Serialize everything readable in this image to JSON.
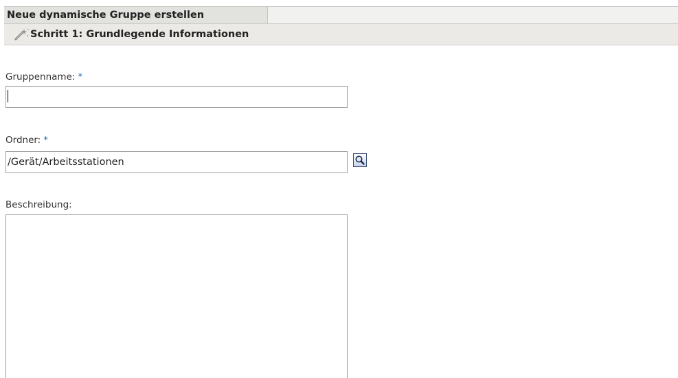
{
  "header": {
    "title": "Neue dynamische Gruppe erstellen"
  },
  "step": {
    "title": "Schritt 1: Grundlegende Informationen",
    "icon": "wizard-wand-icon"
  },
  "form": {
    "required_marker": "*",
    "group_name": {
      "label": "Gruppenname:",
      "value": ""
    },
    "folder": {
      "label": "Ordner:",
      "value": "/Gerät/Arbeitsstationen",
      "browse_icon": "magnifier-icon"
    },
    "description": {
      "label": "Beschreibung:",
      "value": ""
    }
  },
  "colors": {
    "required_marker": "#2b6fb3",
    "title_bar_background": "#e2e2df",
    "step_bar_background": "#eceae6"
  }
}
